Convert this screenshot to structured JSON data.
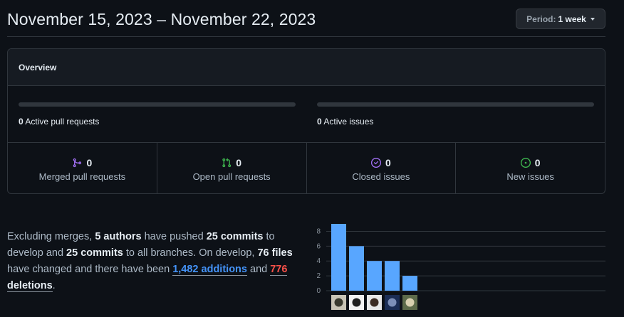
{
  "header": {
    "title": "November 15, 2023 – November 22, 2023",
    "period_label": "Period:",
    "period_value": "1 week"
  },
  "overview": {
    "title": "Overview",
    "active_prs_count": "0",
    "active_prs_label": "Active pull requests",
    "active_issues_count": "0",
    "active_issues_label": "Active issues",
    "stats": [
      {
        "count": "0",
        "label": "Merged pull requests",
        "icon": "git-merge-icon",
        "color": "#a371f7"
      },
      {
        "count": "0",
        "label": "Open pull requests",
        "icon": "git-pull-request-icon",
        "color": "#3fb950"
      },
      {
        "count": "0",
        "label": "Closed issues",
        "icon": "issue-closed-icon",
        "color": "#a371f7"
      },
      {
        "count": "0",
        "label": "New issues",
        "icon": "issue-opened-icon",
        "color": "#3fb950"
      }
    ]
  },
  "summary": {
    "t1": "Excluding merges, ",
    "authors": "5 authors",
    "t2": " have pushed ",
    "commits_develop": "25 commits",
    "t3": " to develop and ",
    "commits_all": "25 commits",
    "t4": " to all branches. On develop, ",
    "files": "76 files",
    "t5": " have changed and there have been ",
    "additions_num": "1,482",
    "additions_word": " additions",
    "t6": " and ",
    "deletions_num": "776",
    "deletions_word": " deletions",
    "t7": "."
  },
  "chart_data": {
    "type": "bar",
    "values": [
      9,
      6,
      4,
      4,
      2
    ],
    "ylim": [
      0,
      9
    ],
    "yticks": [
      "0",
      "2",
      "4",
      "6",
      "8"
    ],
    "bar_color": "#58a6ff",
    "grid": true,
    "categories_are_avatars": true
  }
}
